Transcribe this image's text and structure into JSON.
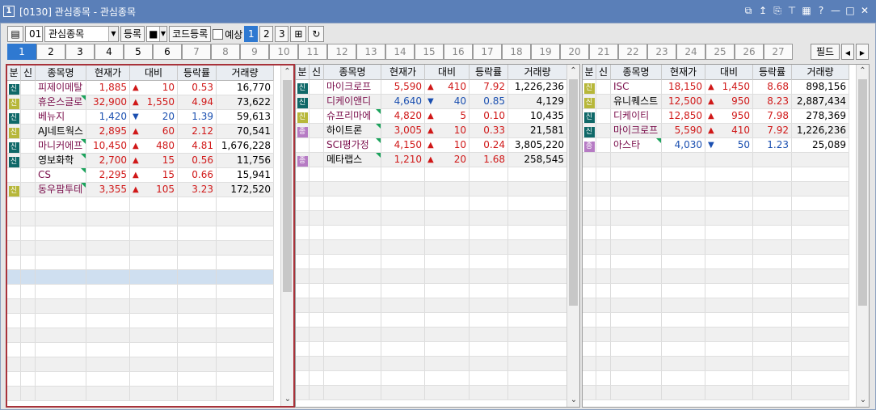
{
  "window": {
    "num": "1",
    "title": "[0130] 관심종목 - 관심종목",
    "buttons": [
      "⧉",
      "↥",
      "⎘",
      "⊤",
      "▦",
      "?",
      "—",
      "□",
      "✕"
    ]
  },
  "toolbar": {
    "group_num": "01",
    "group_name": "관심종목",
    "register": "등록",
    "code_register": "코드등록",
    "expect_label": "예상",
    "pages": [
      "1",
      "2",
      "3"
    ]
  },
  "tabs": [
    "1",
    "2",
    "3",
    "4",
    "5",
    "6",
    "7",
    "8",
    "9",
    "10",
    "11",
    "12",
    "13",
    "14",
    "15",
    "16",
    "17",
    "18",
    "19",
    "20",
    "21",
    "22",
    "23",
    "24",
    "25",
    "26",
    "27"
  ],
  "field_button": "필드",
  "columns": [
    "분",
    "신",
    "종목명",
    "현재가",
    "대비",
    "등락률",
    "거래량"
  ],
  "panels": [
    {
      "rows": [
        {
          "badge": "신",
          "bc": "s",
          "name": "피제이메탈",
          "nc": "m",
          "tri": false,
          "price": "1,885",
          "pc": "up",
          "arrow": "▲",
          "ac": "up",
          "change": "10",
          "cc": "up",
          "rate": "0.53",
          "rc": "up",
          "vol": "16,770"
        },
        {
          "badge": "신",
          "bc": "y",
          "name": "휴온스글로",
          "nc": "m",
          "tri": true,
          "price": "32,900",
          "pc": "up",
          "arrow": "▲",
          "ac": "up",
          "change": "1,550",
          "cc": "up",
          "rate": "4.94",
          "rc": "up",
          "vol": "73,622"
        },
        {
          "badge": "신",
          "bc": "s",
          "name": "베뉴지",
          "nc": "m",
          "tri": false,
          "price": "1,420",
          "pc": "dn",
          "arrow": "▼",
          "ac": "dn",
          "change": "20",
          "cc": "dn",
          "rate": "1.39",
          "rc": "dn",
          "vol": "59,613"
        },
        {
          "badge": "신",
          "bc": "y",
          "name": "AJ네트웍스",
          "nc": "k",
          "tri": false,
          "price": "2,895",
          "pc": "up",
          "arrow": "▲",
          "ac": "up",
          "change": "60",
          "cc": "up",
          "rate": "2.12",
          "rc": "up",
          "vol": "70,541"
        },
        {
          "badge": "신",
          "bc": "s",
          "name": "마니커에프",
          "nc": "m",
          "tri": true,
          "price": "10,450",
          "pc": "up",
          "arrow": "▲",
          "ac": "up",
          "change": "480",
          "cc": "up",
          "rate": "4.81",
          "rc": "up",
          "vol": "1,676,228"
        },
        {
          "badge": "신",
          "bc": "s",
          "name": "영보화학",
          "nc": "k",
          "tri": true,
          "price": "2,700",
          "pc": "up",
          "arrow": "▲",
          "ac": "up",
          "change": "15",
          "cc": "up",
          "rate": "0.56",
          "rc": "up",
          "vol": "11,756"
        },
        {
          "badge": "",
          "bc": "",
          "name": "CS",
          "nc": "m",
          "tri": true,
          "price": "2,295",
          "pc": "up",
          "arrow": "▲",
          "ac": "up",
          "change": "15",
          "cc": "up",
          "rate": "0.66",
          "rc": "up",
          "vol": "15,941"
        },
        {
          "badge": "신",
          "bc": "y",
          "name": "동우팜투테",
          "nc": "m",
          "tri": true,
          "price": "3,355",
          "pc": "up",
          "arrow": "▲",
          "ac": "up",
          "change": "105",
          "cc": "up",
          "rate": "3.23",
          "rc": "up",
          "vol": "172,520"
        }
      ]
    },
    {
      "rows": [
        {
          "badge": "신",
          "bc": "s",
          "name": "마이크로프",
          "nc": "m",
          "tri": false,
          "price": "5,590",
          "pc": "up",
          "arrow": "▲",
          "ac": "up",
          "change": "410",
          "cc": "up",
          "rate": "7.92",
          "rc": "up",
          "vol": "1,226,236"
        },
        {
          "badge": "신",
          "bc": "s",
          "name": "디케이앤디",
          "nc": "m",
          "tri": false,
          "price": "4,640",
          "pc": "dn",
          "arrow": "▼",
          "ac": "dn",
          "change": "40",
          "cc": "dn",
          "rate": "0.85",
          "rc": "dn",
          "vol": "4,129"
        },
        {
          "badge": "신",
          "bc": "y",
          "name": "슈프리마에",
          "nc": "m",
          "tri": true,
          "price": "4,820",
          "pc": "up",
          "arrow": "▲",
          "ac": "up",
          "change": "5",
          "cc": "up",
          "rate": "0.10",
          "rc": "up",
          "vol": "10,435"
        },
        {
          "badge": "종",
          "bc": "p",
          "name": "하이트론",
          "nc": "k",
          "tri": true,
          "price": "3,005",
          "pc": "up",
          "arrow": "▲",
          "ac": "up",
          "change": "10",
          "cc": "up",
          "rate": "0.33",
          "rc": "up",
          "vol": "21,581"
        },
        {
          "badge": "",
          "bc": "",
          "name": "SCI평가정",
          "nc": "m",
          "tri": true,
          "price": "4,150",
          "pc": "up",
          "arrow": "▲",
          "ac": "up",
          "change": "10",
          "cc": "up",
          "rate": "0.24",
          "rc": "up",
          "vol": "3,805,220"
        },
        {
          "badge": "종",
          "bc": "p",
          "name": "메타랩스",
          "nc": "k",
          "tri": true,
          "price": "1,210",
          "pc": "up",
          "arrow": "▲",
          "ac": "up",
          "change": "20",
          "cc": "up",
          "rate": "1.68",
          "rc": "up",
          "vol": "258,545"
        }
      ]
    },
    {
      "rows": [
        {
          "badge": "신",
          "bc": "y",
          "name": "ISC",
          "nc": "m",
          "tri": false,
          "price": "18,150",
          "pc": "up",
          "arrow": "▲",
          "ac": "up",
          "change": "1,450",
          "cc": "up",
          "rate": "8.68",
          "rc": "up",
          "vol": "898,156"
        },
        {
          "badge": "신",
          "bc": "y",
          "name": "유니퀘스트",
          "nc": "k",
          "tri": false,
          "price": "12,500",
          "pc": "up",
          "arrow": "▲",
          "ac": "up",
          "change": "950",
          "cc": "up",
          "rate": "8.23",
          "rc": "up",
          "vol": "2,887,434"
        },
        {
          "badge": "신",
          "bc": "s",
          "name": "디케이티",
          "nc": "m",
          "tri": false,
          "price": "12,850",
          "pc": "up",
          "arrow": "▲",
          "ac": "up",
          "change": "950",
          "cc": "up",
          "rate": "7.98",
          "rc": "up",
          "vol": "278,369"
        },
        {
          "badge": "신",
          "bc": "s",
          "name": "마이크로프",
          "nc": "m",
          "tri": false,
          "price": "5,590",
          "pc": "up",
          "arrow": "▲",
          "ac": "up",
          "change": "410",
          "cc": "up",
          "rate": "7.92",
          "rc": "up",
          "vol": "1,226,236"
        },
        {
          "badge": "종",
          "bc": "p",
          "name": "아스타",
          "nc": "m",
          "tri": true,
          "price": "4,030",
          "pc": "dn",
          "arrow": "▼",
          "ac": "dn",
          "change": "50",
          "cc": "dn",
          "rate": "1.23",
          "rc": "dn",
          "vol": "25,089"
        }
      ]
    }
  ],
  "colors": {
    "up": "#d01818",
    "down": "#1a4fb0",
    "title_bar": "#5a7fb8",
    "selected_border": "#a8323a",
    "active_tab": "#2f79d1"
  }
}
